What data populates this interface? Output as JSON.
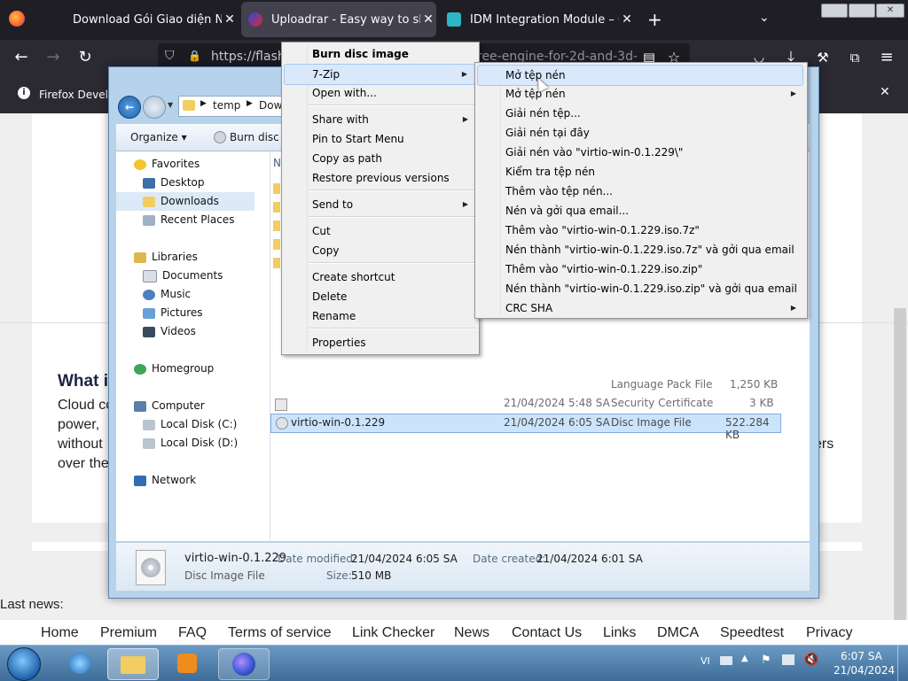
{
  "browser": {
    "tabs": [
      {
        "title": "Download Gói Giao diện Ngôn"
      },
      {
        "title": "Uploadrar - Easy way to share y"
      },
      {
        "title": "IDM Integration Module – Get th"
      }
    ],
    "url": "https://flash.",
    "url_tail": "ree-engine-for-2d-and-3d-",
    "notice": "Firefox Develop"
  },
  "page": {
    "heading": "What i",
    "lines": [
      "Cloud co",
      "power,",
      "without",
      "over the"
    ],
    "right_fragment": "ers",
    "last_news": "Last news:",
    "footer_links": [
      "Home",
      "Premium",
      "FAQ",
      "Terms of service",
      "Link Checker",
      "News",
      "Contact Us",
      "Links",
      "DMCA",
      "Speedtest",
      "Privacy"
    ]
  },
  "explorer": {
    "breadcrumb": [
      "temp",
      "Dow"
    ],
    "toolbar": {
      "organize": "Organize",
      "burn": "Burn disc i"
    },
    "nav": {
      "favorites": "Favorites",
      "desktop": "Desktop",
      "downloads": "Downloads",
      "recent": "Recent Places",
      "libraries": "Libraries",
      "documents": "Documents",
      "music": "Music",
      "pictures": "Pictures",
      "videos": "Videos",
      "homegroup": "Homegroup",
      "computer": "Computer",
      "local_c": "Local Disk (C:)",
      "local_d": "Local Disk (D:)",
      "network": "Network"
    },
    "list_header_fragment": "N",
    "files": [
      {
        "name": "",
        "date": "",
        "type": "Language Pack File",
        "size": "1,250 KB"
      },
      {
        "name": "",
        "date": "21/04/2024 5:48 SA",
        "type": "Security Certificate",
        "size": "3 KB"
      },
      {
        "name": "virtio-win-0.1.229",
        "date": "21/04/2024 6:05 SA",
        "type": "Disc Image File",
        "size": "522.284 KB"
      }
    ],
    "details": {
      "name": "virtio-win-0.1.229",
      "type": "Disc Image File",
      "modified_label": "Date modified:",
      "modified": "21/04/2024 6:05 SA",
      "created_label": "Date created:",
      "created": "21/04/2024 6:01 SA",
      "size_label": "Size:",
      "size": "510 MB"
    }
  },
  "context_menu": {
    "items": [
      "Burn disc image",
      "7-Zip",
      "Open with...",
      "Share with",
      "Pin to Start Menu",
      "Copy as path",
      "Restore previous versions",
      "Send to",
      "Cut",
      "Copy",
      "Create shortcut",
      "Delete",
      "Rename",
      "Properties"
    ]
  },
  "submenu_7zip": {
    "items": [
      "Mở tệp nén",
      "Mở tệp nén",
      "Giải nén tệp...",
      "Giải nén tại đây",
      "Giải nén vào \"virtio-win-0.1.229\\\"",
      "Kiểm tra tệp nén",
      "Thêm vào tệp nén...",
      "Nén và gởi qua email...",
      "Thêm vào \"virtio-win-0.1.229.iso.7z\"",
      "Nén thành \"virtio-win-0.1.229.iso.7z\" và gởi qua email",
      "Thêm vào \"virtio-win-0.1.229.iso.zip\"",
      "Nén thành \"virtio-win-0.1.229.iso.zip\" và gởi qua email",
      "CRC SHA"
    ]
  },
  "taskbar": {
    "lang": "VI",
    "time": "6:07 SA",
    "date": "21/04/2024"
  },
  "icons": [
    "firefox-icon",
    "back-icon",
    "forward-icon",
    "reload-icon",
    "shield-icon",
    "lock-icon",
    "reader-icon",
    "star-icon",
    "pocket-icon",
    "download-icon",
    "wrench-icon",
    "extensions-icon",
    "menu-icon",
    "info-icon",
    "close-icon",
    "folder-icon",
    "disc-icon",
    "start-orb-icon"
  ]
}
